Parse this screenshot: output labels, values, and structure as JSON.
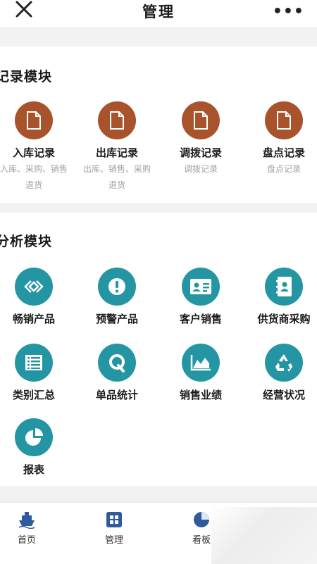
{
  "header": {
    "title": "管理",
    "close_icon": "close-icon",
    "more_label": "•••"
  },
  "record_module": {
    "title": "记录模块",
    "items": [
      {
        "label": "入库记录",
        "sub1": "入库、采购、销售",
        "sub2": "退货",
        "icon": "document-icon"
      },
      {
        "label": "出库记录",
        "sub1": "出库、销售、采购",
        "sub2": "退货",
        "icon": "document-icon"
      },
      {
        "label": "调拨记录",
        "sub1": "调拨记录",
        "sub2": "",
        "icon": "document-icon"
      },
      {
        "label": "盘点记录",
        "sub1": "盘点记录",
        "sub2": "",
        "icon": "document-icon"
      }
    ]
  },
  "analysis_module": {
    "title": "分析模块",
    "items": [
      {
        "label": "畅销产品",
        "icon": "diamond-link-icon"
      },
      {
        "label": "预警产品",
        "icon": "alert-icon"
      },
      {
        "label": "客户销售",
        "icon": "id-card-icon"
      },
      {
        "label": "供货商采购",
        "icon": "contact-book-icon"
      },
      {
        "label": "类别汇总",
        "icon": "list-icon"
      },
      {
        "label": "单品统计",
        "icon": "q-icon"
      },
      {
        "label": "销售业绩",
        "icon": "area-chart-icon"
      },
      {
        "label": "经营状况",
        "icon": "recycle-icon"
      },
      {
        "label": "报表",
        "icon": "pie-chart-icon"
      }
    ]
  },
  "tabbar": {
    "items": [
      {
        "label": "首页",
        "icon": "ship-icon"
      },
      {
        "label": "管理",
        "icon": "grid-icon"
      },
      {
        "label": "看板",
        "icon": "pie-icon"
      }
    ]
  },
  "colors": {
    "record_icon_bg": "#a8532c",
    "analysis_icon_bg": "#2496a3",
    "tab_icon": "#2f5a9e"
  }
}
